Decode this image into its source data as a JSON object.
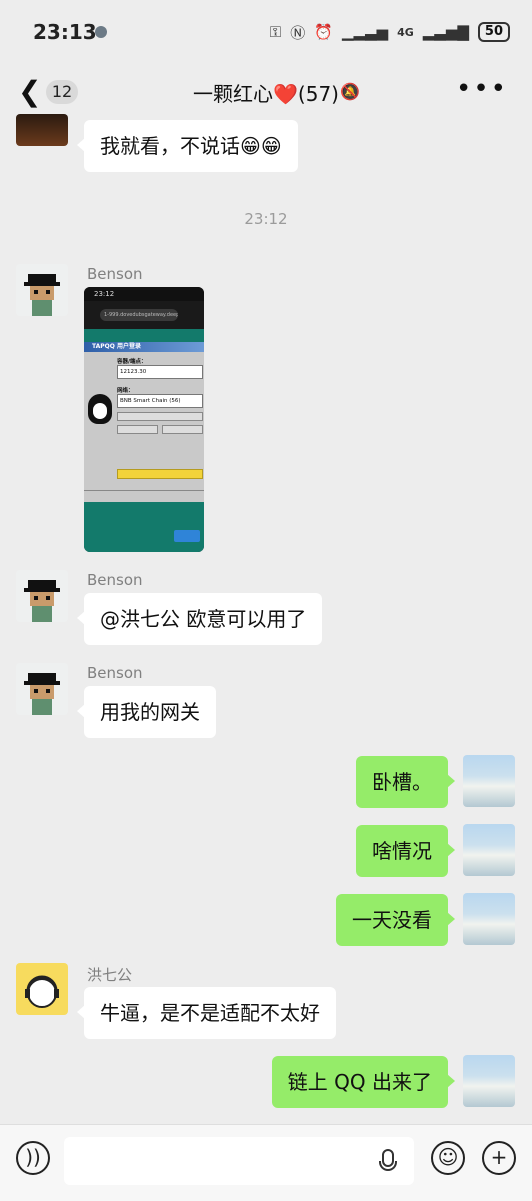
{
  "status_bar": {
    "time": "23:13",
    "network": "4G",
    "battery": "50"
  },
  "header": {
    "back_count": "12",
    "title": "一颗红心❤️(57)"
  },
  "messages": {
    "m0": {
      "text": "我就看，不说话😁😁"
    },
    "timestamp": "23:12",
    "m1": {
      "sender": "Benson"
    },
    "screenshot": {
      "time": "23:12",
      "url": "1-999.dovedubsgateway.deepstore",
      "title": "TAPQQ 用户登录",
      "label_nick": "容器/端点：",
      "value_nick": "12123.30",
      "label_net": "网络：",
      "value_net": "BNB Smart Chain (56)"
    },
    "m2": {
      "sender": "Benson",
      "text": "@洪七公  欧意可以用了"
    },
    "m3": {
      "sender": "Benson",
      "text": "用我的网关"
    },
    "m4": {
      "text": "卧槽。"
    },
    "m5": {
      "text": "啥情况"
    },
    "m6": {
      "text": "一天没看"
    },
    "m7": {
      "sender": "洪七公",
      "text": "牛逼，是不是适配不太好"
    },
    "m8": {
      "text": "链上 QQ 出来了"
    }
  },
  "colors": {
    "outgoing_bubble": "#95ec69",
    "incoming_bubble": "#ffffff",
    "background": "#ededed"
  }
}
